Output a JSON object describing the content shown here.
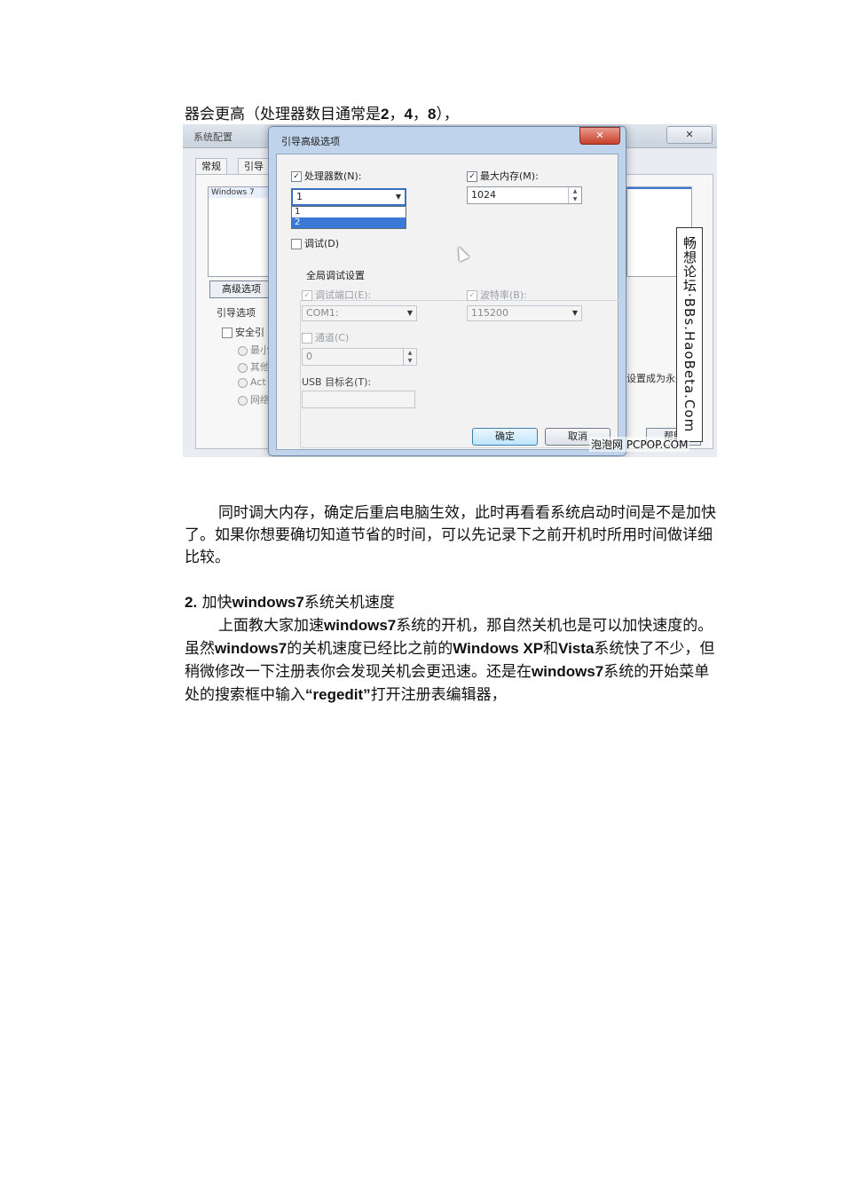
{
  "page": {
    "line1": {
      "pre": "器会更高（处理器数目通常是",
      "n1": "2",
      "sep1": "，",
      "n2": "4",
      "sep2": "，",
      "n3": "8",
      "post": "），"
    },
    "para1": "同时调大内存，确定后重启电脑生效，此时再看看系统启动时间是不是加快了。如果你想要确切知道节省的时间，可以先记录下之前开机时所用时间做详细比较。",
    "heading": {
      "num": "2.",
      "pre": "加快",
      "bold": "windows7",
      "post": "系统关机速度"
    },
    "para2": {
      "t1": "上面教大家加速",
      "b1": "windows7",
      "t2": "系统的开机，那自然关机也是可以加快速度的。虽然",
      "b2": "windows7",
      "t3": "的关机速度已经比之前的",
      "b3": "Windows XP",
      "t4": "和",
      "b4": "Vista",
      "t5": "系统快了不少，但稍微修改一下注册表你会发现关机会更迅速。还是在",
      "b5": "windows7",
      "t6": "系统的开始菜单处的搜索框中输入",
      "b6": "“regedit”",
      "t7": "打开注册表编辑器，"
    }
  },
  "screenshot": {
    "bg_title": "系统配置",
    "bg_close": "✕",
    "bg_tabs": [
      "常规",
      "引导"
    ],
    "os_item": "Windows 7",
    "os_item_right": "",
    "adv_button": "高级选项",
    "boot_options": "引导选项",
    "safe_boot": "安全引",
    "radio_items": [
      "最小",
      "其他",
      "Act",
      "网络"
    ],
    "right_text": "设置成为永久",
    "help_button": "帮助",
    "dialog": {
      "title": "引导高级选项",
      "close": "✕",
      "num_proc_label": "处理器数(N):",
      "num_proc_value": "1",
      "dropdown_items": [
        "1",
        "2"
      ],
      "max_mem_label": "最大内存(M):",
      "max_mem_value": "1024",
      "debug_label": "调试(D)",
      "global_debug": "全局调试设置",
      "debug_port_label": "调试端口(E):",
      "debug_port_value": "COM1:",
      "baud_label": "波特率(B):",
      "baud_value": "115200",
      "channel_label": "通道(C)",
      "channel_value": "0",
      "usb_label": "USB 目标名(T):",
      "ok": "确定",
      "cancel": "取消"
    },
    "watermark_vertical": "畅想论坛·BBs.HaoBeta.Com",
    "watermark_bottom": "泡泡网 PCPOP.COM"
  }
}
